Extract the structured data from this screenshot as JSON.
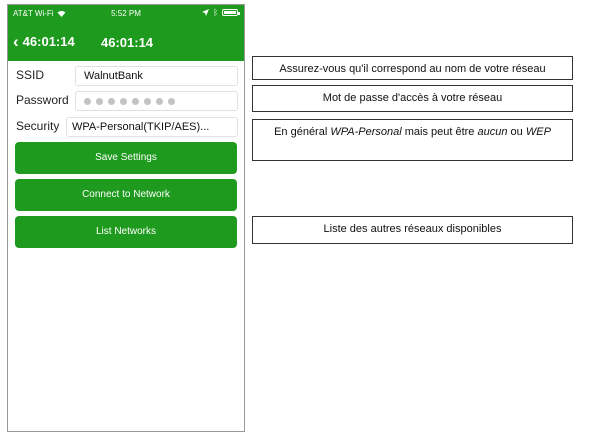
{
  "status_bar": {
    "carrier": "AT&T Wi-Fi",
    "time": "5:52 PM"
  },
  "navbar": {
    "back_label": "46:01:14",
    "title": "46:01:14"
  },
  "form": {
    "ssid_label": "SSID",
    "ssid_value": "WalnutBank",
    "password_label": "Password",
    "security_label": "Security",
    "security_value": "WPA-Personal(TKIP/AES)..."
  },
  "buttons": {
    "save": "Save Settings",
    "connect": "Connect to Network",
    "list": "List Networks"
  },
  "annotations": {
    "ssid_note": "Assurez-vous qu'il correspond au nom de votre réseau",
    "password_note": "Mot de passe d'accès à votre réseau",
    "security_note_part1": "En général ",
    "security_note_em1": "WPA-Personal",
    "security_note_part2": " mais peut être ",
    "security_note_em2": "aucun",
    "security_note_part3": " ou ",
    "security_note_em3": "WEP",
    "list_note": "Liste des autres réseaux disponibles"
  },
  "colors": {
    "accent": "#1e9a1e",
    "border": "#333333"
  }
}
